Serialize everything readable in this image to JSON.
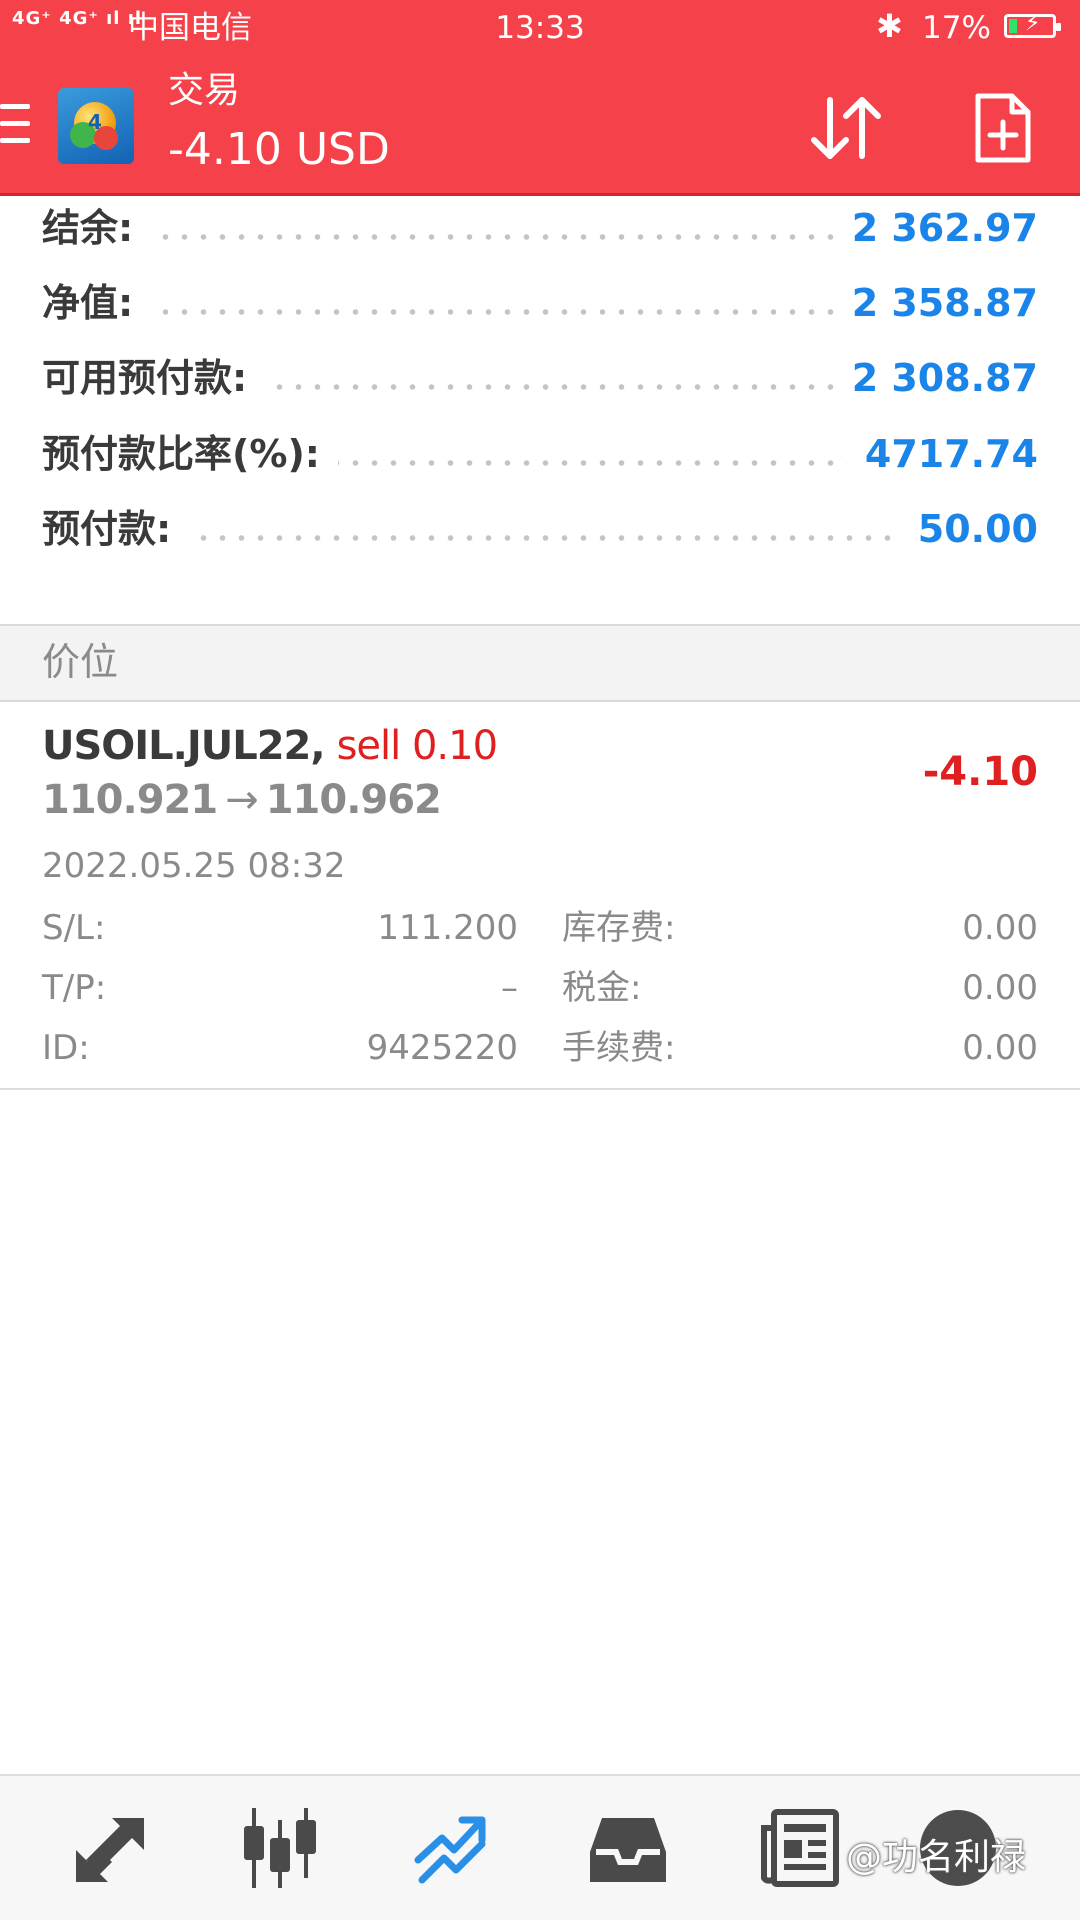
{
  "status_bar": {
    "signal": "4G⁺ 4G⁺ ıl ıl",
    "carrier": "中国电信",
    "time": "13:33",
    "bluetooth_icon": "bluetooth-icon",
    "battery_percent": "17%",
    "battery_level": 0.17
  },
  "app_bar": {
    "title": "交易",
    "balance": "-4.10 USD",
    "icons": [
      "menu-icon",
      "metatrader4-logo",
      "sort-icon",
      "new-order-icon"
    ]
  },
  "summary": [
    {
      "label": "结余:",
      "value": "2 362.97"
    },
    {
      "label": "净值:",
      "value": "2 358.87"
    },
    {
      "label": "可用预付款:",
      "value": "2 308.87"
    },
    {
      "label": "预付款比率(%):",
      "value": "4717.74"
    },
    {
      "label": "预付款:",
      "value": "50.00"
    }
  ],
  "section": {
    "title": "价位"
  },
  "position": {
    "symbol": "USOIL.JUL22",
    "comma": ",",
    "side": "sell 0.10",
    "open_price": "110.921",
    "arrow": "→",
    "current_price": "110.962",
    "profit": "-4.10",
    "time": "2022.05.25 08:32",
    "sl_label": "S/L:",
    "sl_value": "111.200",
    "tp_label": "T/P:",
    "tp_value": "–",
    "id_label": "ID:",
    "id_value": "9425220",
    "swap_label": "库存费:",
    "swap_value": "0.00",
    "tax_label": "税金:",
    "tax_value": "0.00",
    "commission_label": "手续费:",
    "commission_value": "0.00"
  },
  "bottom_nav": {
    "items": [
      "quotes-icon",
      "chart-icon",
      "trade-icon",
      "history-icon",
      "news-icon",
      "chat-icon"
    ],
    "active": "trade-icon",
    "watermark": "@功名利禄"
  },
  "colors": {
    "header": "#f5414a",
    "value_blue": "#1a84e8",
    "loss_red": "#e02020",
    "active_nav": "#2a8fe6"
  }
}
